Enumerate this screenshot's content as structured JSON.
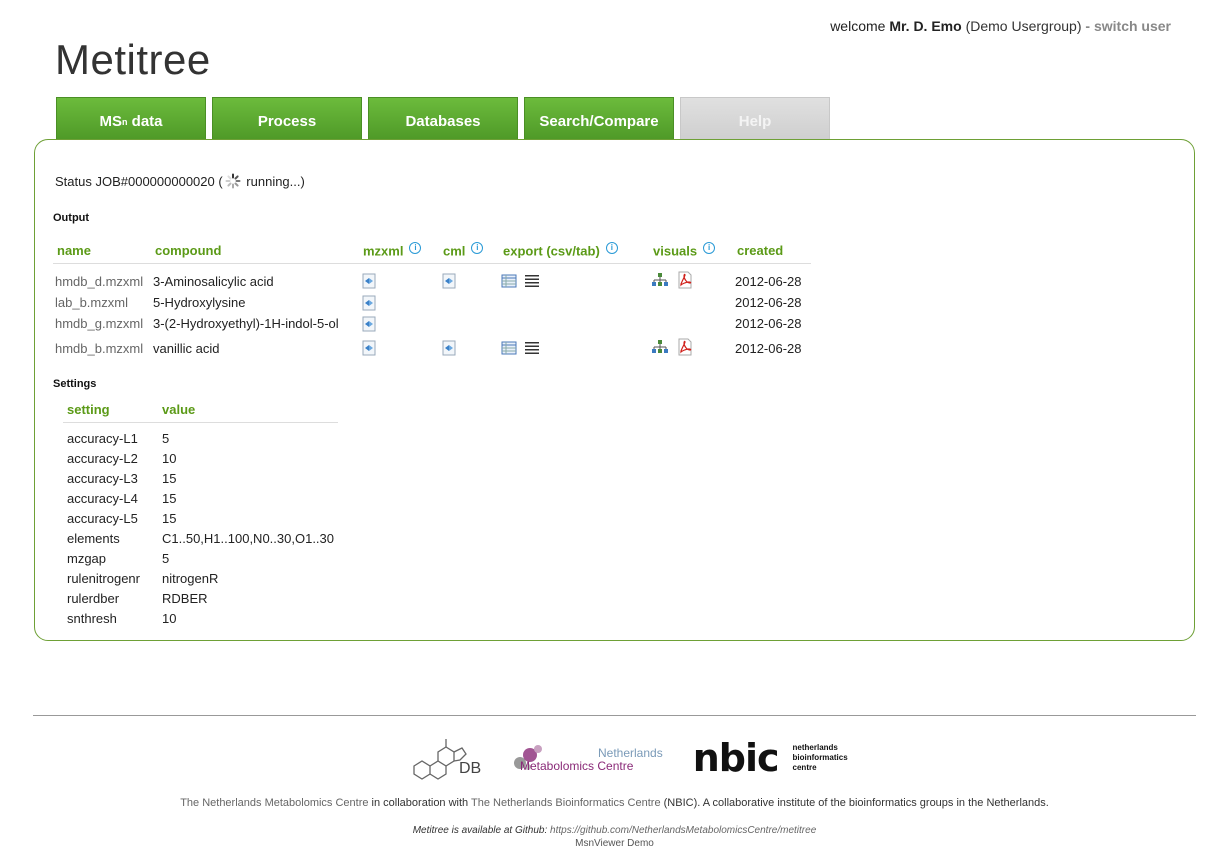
{
  "header": {
    "welcome_prefix": "welcome",
    "user_name": "Mr. D. Emo",
    "user_group": "(Demo Usergroup)",
    "separator": "-",
    "switch_user": "switch user"
  },
  "logo": "Metitree",
  "tabs": [
    {
      "label": "MS",
      "sup": "n",
      "suffix": " data"
    },
    {
      "label": "Process"
    },
    {
      "label": "Databases"
    },
    {
      "label": "Search/Compare"
    },
    {
      "label": "Help"
    }
  ],
  "status": {
    "prefix": "Status JOB#000000000020 (",
    "suffix": " running...)"
  },
  "output": {
    "title": "Output",
    "columns": {
      "name": "name",
      "compound": "compound",
      "mzxml": "mzxml",
      "cml": "cml",
      "export": "export (csv/tab)",
      "visuals": "visuals",
      "created": "created"
    },
    "rows": [
      {
        "name": "hmdb_d.mzxml",
        "compound": "3-Aminosalicylic acid",
        "created": "2012-06-28"
      },
      {
        "name": "lab_b.mzxml",
        "compound": "5-Hydroxylysine",
        "created": "2012-06-28"
      },
      {
        "name": "hmdb_g.mzxml",
        "compound": "3-(2-Hydroxyethyl)-1H-indol-5-ol",
        "created": "2012-06-28"
      },
      {
        "name": "hmdb_b.mzxml",
        "compound": "vanillic acid",
        "created": "2012-06-28"
      }
    ]
  },
  "settings": {
    "title": "Settings",
    "columns": {
      "setting": "setting",
      "value": "value"
    },
    "rows": [
      {
        "k": "accuracy-L1",
        "v": "5"
      },
      {
        "k": "accuracy-L2",
        "v": "10"
      },
      {
        "k": "accuracy-L3",
        "v": "15"
      },
      {
        "k": "accuracy-L4",
        "v": "15"
      },
      {
        "k": "accuracy-L5",
        "v": "15"
      },
      {
        "k": "elements",
        "v": "C1..50,H1..100,N0..30,O1..30"
      },
      {
        "k": "mzgap",
        "v": "5"
      },
      {
        "k": "rulenitrogenr",
        "v": "nitrogenR"
      },
      {
        "k": "rulerdber",
        "v": "RDBER"
      },
      {
        "k": "snthresh",
        "v": "10"
      }
    ]
  },
  "footer": {
    "db_logo_text": "DB",
    "nmc_line1": "Netherlands",
    "nmc_line2": "Metabolomics Centre",
    "nbic_big": "nbic",
    "nbic_small1": "netherlands",
    "nbic_small2": "bioinformatics",
    "nbic_small3": "centre",
    "credit_link1": "The Netherlands Metabolomics Centre",
    "credit_mid": " in collaboration with ",
    "credit_link2": "The Netherlands Bioinformatics Centre",
    "credit_end": " (NBIC). A collaborative institute of the bioinformatics groups in the Netherlands.",
    "github_prefix": "Metitree is available at Github: ",
    "github_url": "https://github.com/NetherlandsMetabolomicsCentre/metitree",
    "demo": "MsnViewer Demo"
  },
  "colors": {
    "accent": "#5b9a17",
    "tab_green": "#5aaa30",
    "border_green": "#6ea036"
  }
}
